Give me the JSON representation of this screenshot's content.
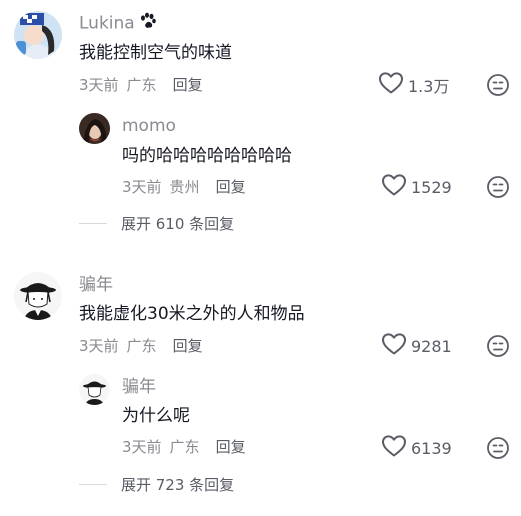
{
  "comments": [
    {
      "user": "Lukina",
      "badge_icon": "paw-icon",
      "text": "我能控制空气的味道",
      "time": "3天前",
      "location": "广东",
      "reply_label": "回复",
      "likes": "1.3万",
      "reply": {
        "user": "momo",
        "text": "吗的哈哈哈哈哈哈哈哈",
        "time": "3天前",
        "location": "贵州",
        "reply_label": "回复",
        "likes": "1529"
      },
      "expand_label": "展开 610 条回复"
    },
    {
      "user": "骗年",
      "text": "我能虚化30米之外的人和物品",
      "time": "3天前",
      "location": "广东",
      "reply_label": "回复",
      "likes": "9281",
      "reply": {
        "user": "骗年",
        "text": "为什么呢",
        "time": "3天前",
        "location": "广东",
        "reply_label": "回复",
        "likes": "6139"
      },
      "expand_label": "展开 723 条回复"
    }
  ],
  "colors": {
    "primary_text": "#161823",
    "secondary_text": "#8a8b91",
    "action_text": "#5a5c66"
  }
}
